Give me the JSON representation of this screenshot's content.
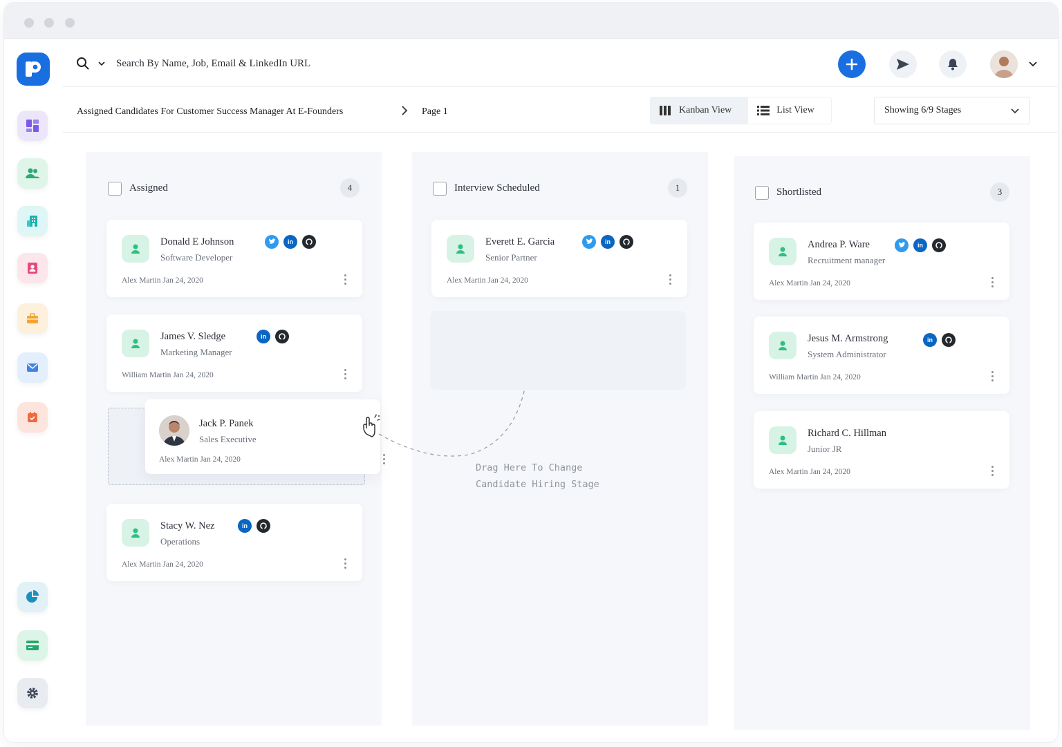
{
  "search": {
    "placeholder": "Search By Name, Job, Email & LinkedIn URL"
  },
  "breadcrumb": {
    "title": "Assigned Candidates For Customer Success Manager At E-Founders",
    "page": "Page 1"
  },
  "views": {
    "kanban": "Kanban View",
    "list": "List View",
    "active": "kanban"
  },
  "stages_select": "Showing 6/9 Stages",
  "columns": [
    {
      "title": "Assigned",
      "count": "4",
      "cards": [
        {
          "name": "Donald E Johnson",
          "role": "Software Developer",
          "meta": "Alex Martin Jan 24, 2020",
          "socials": [
            "twitter",
            "linkedin",
            "github"
          ]
        },
        {
          "name": "James V. Sledge",
          "role": "Marketing Manager",
          "meta": "William Martin Jan 24, 2020",
          "socials": [
            "linkedin",
            "github"
          ]
        },
        {
          "name": "Jack P. Panek",
          "role": "Sales Executive",
          "meta": "Alex Martin Jan 24, 2020",
          "socials": []
        },
        {
          "name": "Stacy W. Nez",
          "role": "Operations",
          "meta": "Alex Martin Jan 24, 2020",
          "socials": [
            "linkedin",
            "github"
          ]
        }
      ]
    },
    {
      "title": "Interview Scheduled",
      "count": "1",
      "cards": [
        {
          "name": "Everett E. Garcia",
          "role": "Senior Partner",
          "meta": "Alex Martin Jan 24, 2020",
          "socials": [
            "twitter",
            "linkedin",
            "github"
          ]
        }
      ],
      "drop_hint": {
        "line1": "Drag Here To Change",
        "line2": "Candidate Hiring Stage"
      }
    },
    {
      "title": "Shortlisted",
      "count": "3",
      "cards": [
        {
          "name": "Andrea P. Ware",
          "role": "Recruitment manager",
          "meta": "Alex Martin Jan 24, 2020",
          "socials": [
            "twitter",
            "linkedin",
            "github"
          ]
        },
        {
          "name": "Jesus M. Armstrong",
          "role": "System Administrator",
          "meta": "William Martin Jan 24, 2020",
          "socials": [
            "linkedin",
            "github"
          ]
        },
        {
          "name": "Richard C. Hillman",
          "role": "Junior JR",
          "meta": "Alex Martin Jan 24, 2020",
          "socials": []
        }
      ]
    }
  ],
  "social_glyphs": {
    "linkedin": "in"
  },
  "colors": {
    "primary": "#1a6fe0",
    "avatar_bg": "#d7f3e6",
    "avatar_icon": "#2fbf7e",
    "board_bg": "#f5f7fa"
  },
  "sidebar_icons": [
    "dashboard-icon",
    "users-icon",
    "building-icon",
    "contact-card-icon",
    "briefcase-icon",
    "mail-icon",
    "calendar-icon",
    "pie-chart-icon",
    "card-icon",
    "settings-icon"
  ]
}
